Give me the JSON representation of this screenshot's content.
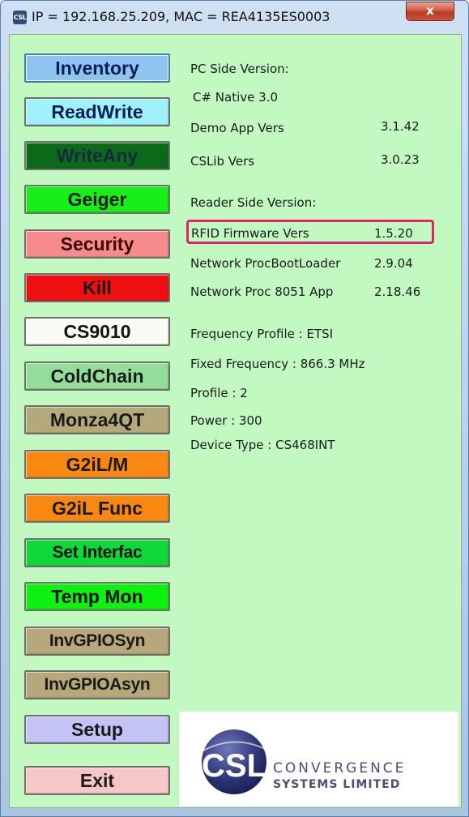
{
  "window": {
    "title": "IP = 192.168.25.209, MAC = REA4135ES0003",
    "app_icon_text": "CSL",
    "close_label": "x"
  },
  "buttons": [
    {
      "label": "Inventory",
      "bg": "#8fc3f2",
      "fg": "#0a1f55"
    },
    {
      "label": "ReadWrite",
      "bg": "#9ff2fb",
      "fg": "#0a1f55"
    },
    {
      "label": "WriteAny",
      "bg": "#0a6a1a",
      "fg": "#1a2a40"
    },
    {
      "label": "Geiger",
      "bg": "#18ee18",
      "fg": "#1a1a1a"
    },
    {
      "label": "Security",
      "bg": "#f78a8a",
      "fg": "#3a0a0a"
    },
    {
      "label": "Kill",
      "bg": "#ee1010",
      "fg": "#1a1a1a"
    },
    {
      "label": "CS9010",
      "bg": "#fbfbf4",
      "fg": "#111111"
    },
    {
      "label": "ColdChain",
      "bg": "#93dd9a",
      "fg": "#1a1a1a"
    },
    {
      "label": "Monza4QT",
      "bg": "#b3a97a",
      "fg": "#1a1a1a"
    },
    {
      "label": "G2iL/M",
      "bg": "#f98812",
      "fg": "#1a1a1a"
    },
    {
      "label": "G2iL Func",
      "bg": "#f98812",
      "fg": "#1a1a1a"
    },
    {
      "label": "Set Interfac",
      "bg": "#0fd83a",
      "fg": "#111111"
    },
    {
      "label": "Temp Mon",
      "bg": "#0ff20f",
      "fg": "#111111"
    },
    {
      "label": "InvGPIOSyn",
      "bg": "#b7a77a",
      "fg": "#1a1a1a"
    },
    {
      "label": "InvGPIOAsyn",
      "bg": "#b7a77a",
      "fg": "#1a1a1a"
    },
    {
      "label": "Setup",
      "bg": "#c3c3f7",
      "fg": "#1a1a1a"
    },
    {
      "label": "Exit",
      "bg": "#f7c6c6",
      "fg": "#1a1a1a"
    }
  ],
  "info": {
    "pc_side_heading": "PC Side Version:",
    "csharp_native": "C# Native 3.0",
    "demo_app_label": "Demo App Vers",
    "demo_app_value": "3.1.42",
    "cslib_label": "CSLib Vers",
    "cslib_value": "3.0.23",
    "reader_side_heading": "Reader Side Version:",
    "rfid_fw_label": "RFID Firmware Vers",
    "rfid_fw_value": "1.5.20",
    "net_boot_label": "Network ProcBootLoader",
    "net_boot_value": "2.9.04",
    "net_app_label": "Network Proc  8051 App",
    "net_app_value": "2.18.46",
    "freq_profile": "Frequency Profile : ETSI",
    "fixed_freq": "Fixed Frequency : 866.3 MHz",
    "profile": "Profile : 2",
    "power": "Power : 300",
    "device_type": "Device Type :   CS468INT"
  },
  "logo": {
    "mark_text": "CSL",
    "line1": "CONVERGENCE",
    "line2": "SYSTEMS LIMITED"
  },
  "colors": {
    "client_bg": "#c1f9c1",
    "highlight_border": "#e0246a"
  }
}
